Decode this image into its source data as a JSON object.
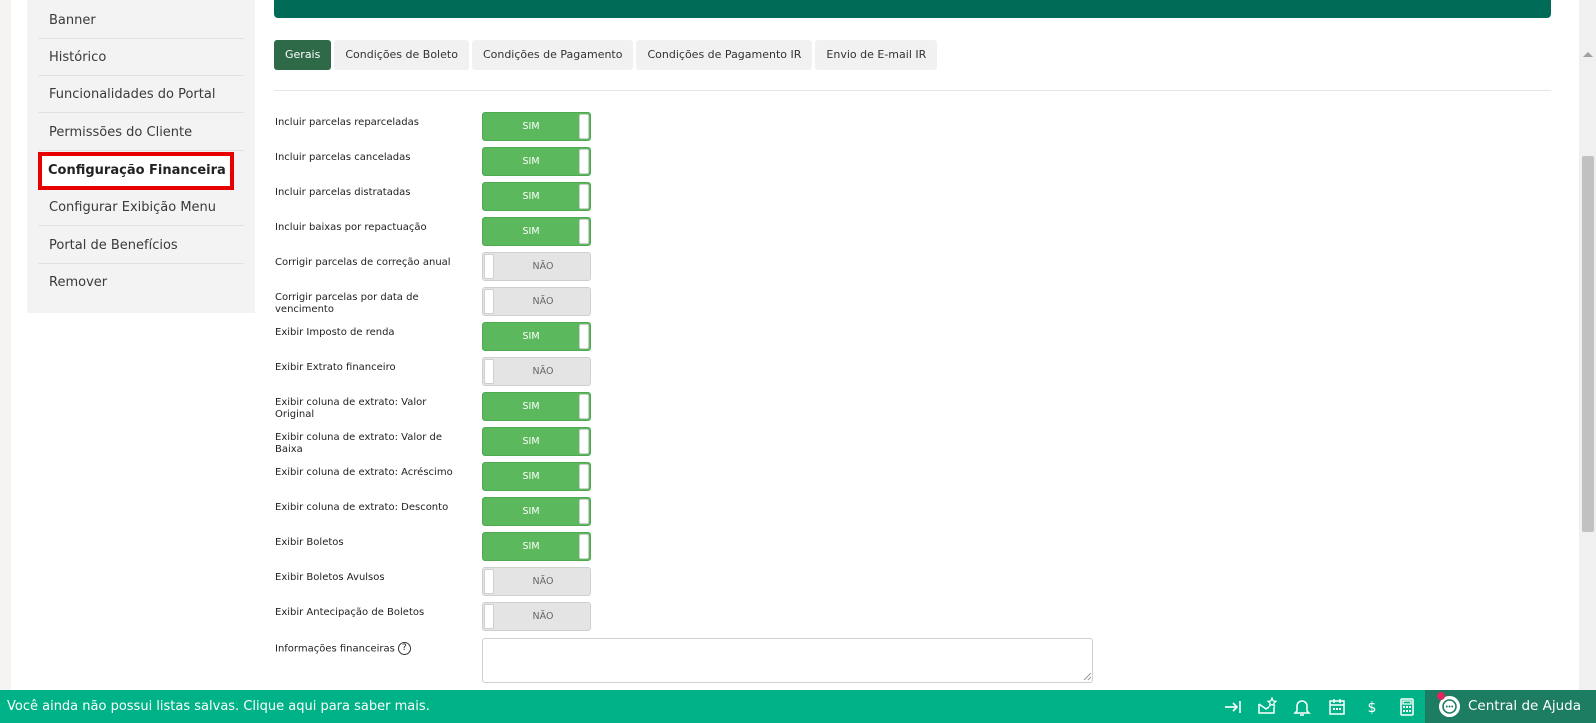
{
  "sidebar": {
    "items": [
      {
        "label": "Banner"
      },
      {
        "label": "Histórico"
      },
      {
        "label": "Funcionalidades do Portal"
      },
      {
        "label": "Permissões do Cliente"
      },
      {
        "label": "Configuração Financeira"
      },
      {
        "label": "Configurar Exibição Menu"
      },
      {
        "label": "Portal de Benefícios"
      },
      {
        "label": "Remover"
      }
    ],
    "active_index": 4
  },
  "tabs": [
    {
      "label": "Gerais"
    },
    {
      "label": "Condições de Boleto"
    },
    {
      "label": "Condições de Pagamento"
    },
    {
      "label": "Condições de Pagamento IR"
    },
    {
      "label": "Envio de E-mail IR"
    }
  ],
  "settings": [
    {
      "label": "Incluir parcelas reparceladas",
      "value": "SIM"
    },
    {
      "label": "Incluir parcelas canceladas",
      "value": "SIM"
    },
    {
      "label": "Incluir parcelas distratadas",
      "value": "SIM"
    },
    {
      "label": "Incluir baixas por repactuação",
      "value": "SIM"
    },
    {
      "label": "Corrigir parcelas de correção anual",
      "value": "NÃO"
    },
    {
      "label": "Corrigir parcelas por data de vencimento",
      "value": "NÃO"
    },
    {
      "label": "Exibir Imposto de renda",
      "value": "SIM"
    },
    {
      "label": "Exibir Extrato financeiro",
      "value": "NÃO"
    },
    {
      "label": "Exibir coluna de extrato: Valor Original",
      "value": "SIM"
    },
    {
      "label": "Exibir coluna de extrato: Valor de Baixa",
      "value": "SIM"
    },
    {
      "label": "Exibir coluna de extrato: Acréscimo",
      "value": "SIM"
    },
    {
      "label": "Exibir coluna de extrato: Desconto",
      "value": "SIM"
    },
    {
      "label": "Exibir Boletos",
      "value": "SIM"
    },
    {
      "label": "Exibir Boletos Avulsos",
      "value": "NÃO"
    },
    {
      "label": "Exibir Antecipação de Boletos",
      "value": "NÃO"
    }
  ],
  "financial_info": {
    "label": "Informações financeiras",
    "value": ""
  },
  "bottom_bar": {
    "message": "Você ainda não possui listas salvas. Clique aqui para saber mais.",
    "icons": [
      "collapse-panel-icon",
      "favorite-mail-icon",
      "bell-icon",
      "calendar-icon",
      "dollar-icon",
      "calculator-icon"
    ],
    "help_center_label": "Central de Ajuda"
  },
  "colors": {
    "primary_dark": "#006b56",
    "tab_active": "#2e6a47",
    "toggle_on": "#5cb85c",
    "toggle_off": "#e4e4e4",
    "bottom_bar": "#00b287",
    "highlight_border": "#e60000"
  }
}
